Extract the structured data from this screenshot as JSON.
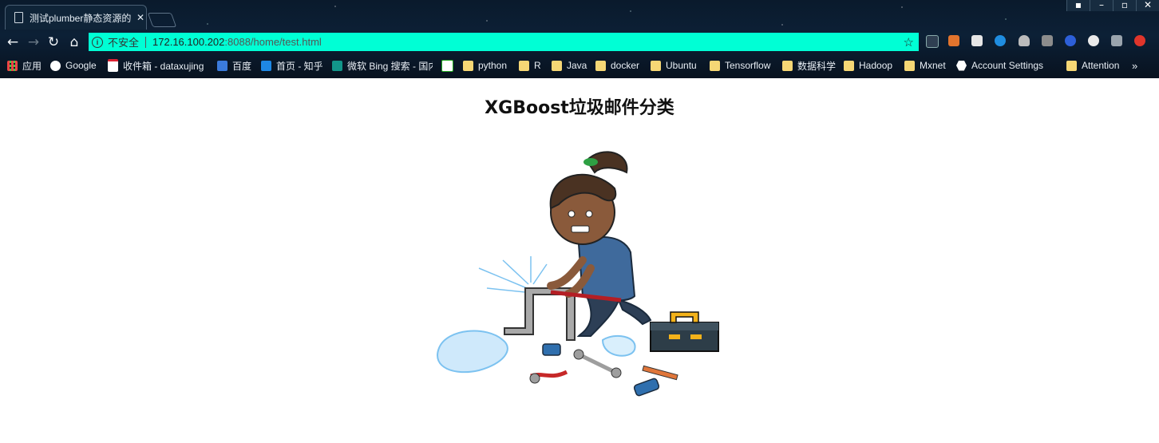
{
  "browser": {
    "tab_title": "测试plumber静态资源的",
    "security_label": "不安全",
    "url_host": "172.16.100.202",
    "url_path": ":8088/home/test.html",
    "omnibox_color": "#00ffd5"
  },
  "bookmarks": [
    {
      "label": "应用",
      "icon": "apps-grid-icon"
    },
    {
      "label": "Google",
      "icon": "google-icon"
    },
    {
      "label": "收件箱 - dataxujing",
      "icon": "gmail-icon"
    },
    {
      "label": "百度",
      "icon": "baidu-icon"
    },
    {
      "label": "首页 - 知乎",
      "icon": "zhihu-icon"
    },
    {
      "label": "微软 Bing 搜索 - 国内",
      "icon": "bing-icon"
    },
    {
      "label": "",
      "icon": "site-icon"
    },
    {
      "label": "python",
      "icon": "folder-icon"
    },
    {
      "label": "R",
      "icon": "folder-icon"
    },
    {
      "label": "Java",
      "icon": "folder-icon"
    },
    {
      "label": "docker",
      "icon": "folder-icon"
    },
    {
      "label": "Ubuntu",
      "icon": "folder-icon"
    },
    {
      "label": "Tensorflow",
      "icon": "folder-icon"
    },
    {
      "label": "数据科学",
      "icon": "folder-icon"
    },
    {
      "label": "Hadoop",
      "icon": "folder-icon"
    },
    {
      "label": "Mxnet",
      "icon": "folder-icon"
    },
    {
      "label": "Account Settings",
      "icon": "hexagon-icon"
    },
    {
      "label": "Attention",
      "icon": "folder-icon"
    }
  ],
  "page": {
    "heading": "XGBoost垃圾邮件分类",
    "illustration": "plumber-fixing-pipe-illustration"
  }
}
